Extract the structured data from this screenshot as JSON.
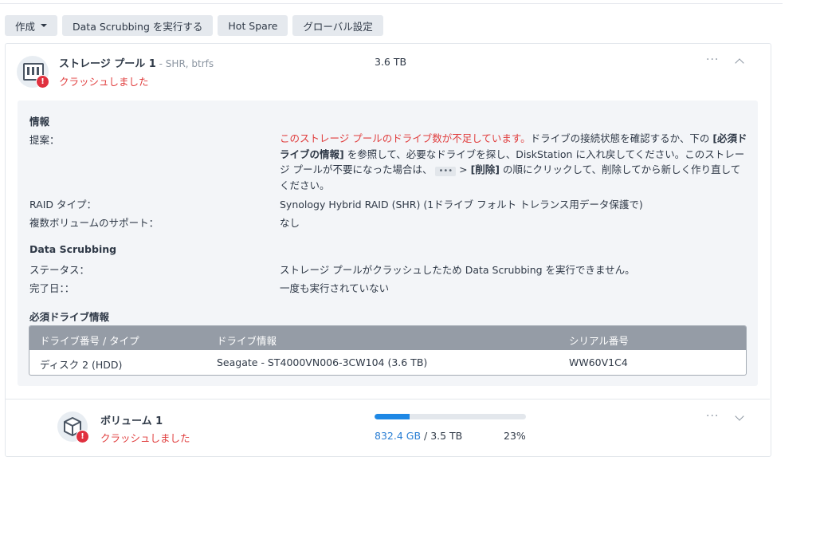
{
  "toolbar": {
    "create": "作成",
    "data_scrubbing": "Data Scrubbing を実行する",
    "hot_spare": "Hot Spare",
    "global_settings": "グローバル設定"
  },
  "pool": {
    "name": "ストレージ プール 1",
    "subtitle": " - SHR, btrfs",
    "status": "クラッシュしました",
    "size": "3.6 TB",
    "more": "···",
    "info": {
      "section_title": "情報",
      "suggestion_label": "提案：",
      "suggestion_red": "このストレージ プールのドライブ数が不足しています。",
      "suggestion_1": "ドライブの接続状態を確認するか、下の ",
      "suggestion_bold_1": "[必須ドライブの情報]",
      "suggestion_2": " を参照して、必要なドライブを探し、DiskStation に入れ戻してください。このストレージ プールが不要になった場合は、 ",
      "suggestion_chip": "•••",
      "suggestion_3": " > ",
      "suggestion_bold_2": "[削除]",
      "suggestion_4": " の順にクリックして、削除してから新しく作り直してください。",
      "raid_label": "RAID タイプ：",
      "raid_value": "Synology Hybrid RAID (SHR) (1ドライブ フォルト トレランス用データ保護で)",
      "multi_label": "複数ボリュームのサポート：",
      "multi_value": "なし"
    },
    "scrubbing": {
      "section_title": "Data Scrubbing",
      "status_label": "ステータス：",
      "status_value": "ストレージ プールがクラッシュしたため Data Scrubbing を実行できません。",
      "done_label": "完了日：：",
      "done_value": "一度も実行されていない"
    },
    "required_drives": {
      "section_title": "必須ドライブ情報",
      "columns": [
        "ドライブ番号 / タイプ",
        "ドライブ情報",
        "シリアル番号"
      ],
      "rows": [
        [
          "ディスク 2 (HDD)",
          "Seagate - ST4000VN006-3CW104 (3.6 TB)",
          "WW60V1C4"
        ]
      ]
    }
  },
  "volume": {
    "name": "ボリューム 1",
    "status": "クラッシュしました",
    "used": "832.4 GB",
    "total": " / 3.5 TB",
    "percent": "23%",
    "usage_fraction": 0.23,
    "more": "···"
  },
  "colors": {
    "error": "#e03c3c",
    "accent": "#1e88e5",
    "table_header": "#959ca6"
  },
  "icons": [
    "chevron-down-icon",
    "chevron-up-icon",
    "storage-pool-icon",
    "volume-icon",
    "error-icon",
    "more-icon"
  ]
}
